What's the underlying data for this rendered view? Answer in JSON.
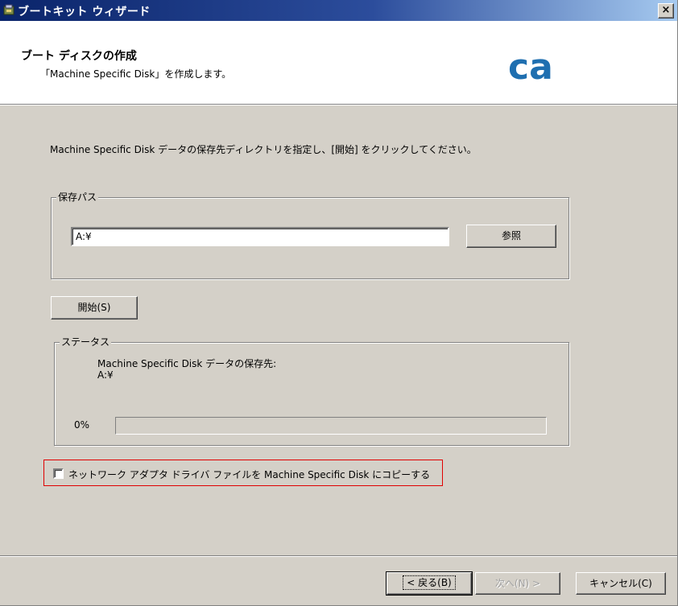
{
  "window": {
    "title": "ブートキット ウィザード",
    "close_label": "×"
  },
  "header": {
    "title": "ブート ディスクの作成",
    "subtitle": "「Machine Specific Disk」を作成します。",
    "logo_text": "ca"
  },
  "main": {
    "instruction": "Machine Specific Disk データの保存先ディレクトリを指定し、[開始] をクリックしてください。",
    "save_path": {
      "group_label": "保存パス",
      "value": "A:¥",
      "browse_label": "参照"
    },
    "start_label": "開始(S)",
    "status": {
      "group_label": "ステータス",
      "line1": "Machine Specific Disk データの保存先:",
      "line2": "A:¥",
      "percent_label": "0%",
      "progress_percent": 0
    },
    "copy_checkbox": {
      "label": "ネットワーク アダプタ ドライバ ファイルを Machine Specific Disk にコピーする",
      "checked": false
    }
  },
  "footer": {
    "back_label": "< 戻る(B)",
    "next_label": "次へ(N) >",
    "cancel_label": "キャンセル(C)"
  },
  "colors": {
    "titlebar": "#0a246a",
    "dialog": "#d4d0c8",
    "highlight_border": "#e00000",
    "logo": "#1f6fb0"
  }
}
